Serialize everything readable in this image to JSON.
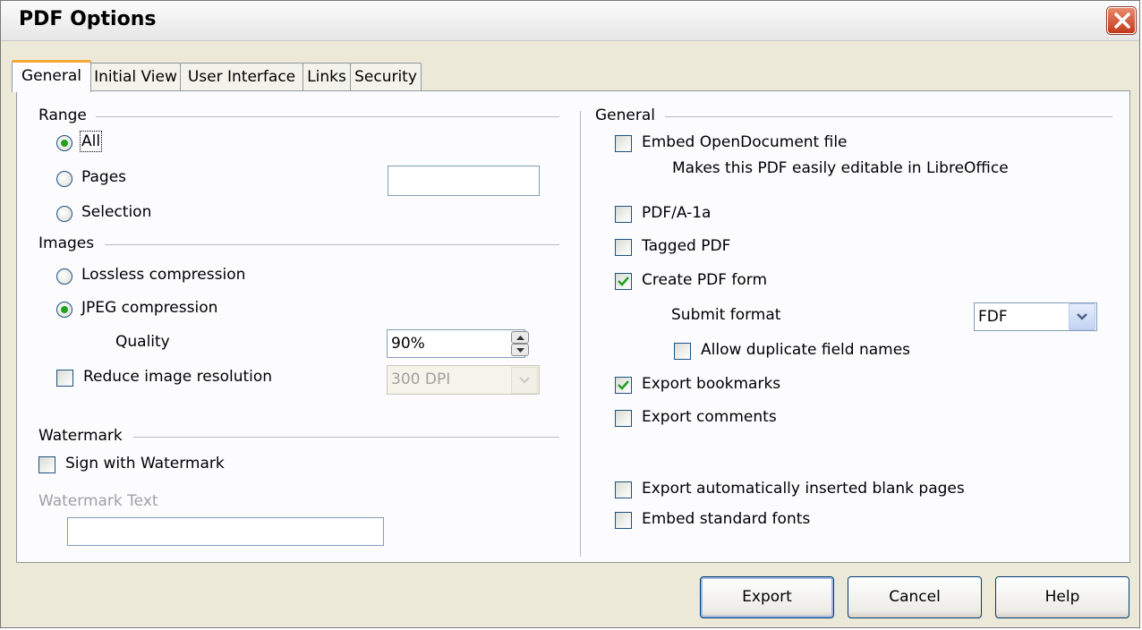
{
  "window": {
    "title": "PDF Options"
  },
  "tabs": [
    {
      "label": "General",
      "active": true
    },
    {
      "label": "Initial View"
    },
    {
      "label": "User Interface"
    },
    {
      "label": "Links"
    },
    {
      "label": "Security"
    }
  ],
  "left": {
    "range": {
      "title": "Range",
      "all": "All",
      "pages": "Pages",
      "pages_value": "",
      "selection": "Selection",
      "selected": "All"
    },
    "images": {
      "title": "Images",
      "lossless": "Lossless compression",
      "jpeg": "JPEG compression",
      "selected": "JPEG compression",
      "quality_label": "Quality",
      "quality_value": "90%",
      "reduce_label": "Reduce image resolution",
      "reduce_checked": false,
      "resolution_value": "300 DPI"
    },
    "watermark": {
      "title": "Watermark",
      "sign_label": "Sign with Watermark",
      "sign_checked": false,
      "text_label": "Watermark Text",
      "text_value": ""
    }
  },
  "right": {
    "title": "General",
    "embed_odf": {
      "label": "Embed OpenDocument file",
      "checked": false,
      "hint": "Makes this PDF easily editable in LibreOffice"
    },
    "pdfa": {
      "label": "PDF/A-1a",
      "checked": false
    },
    "tagged": {
      "label": "Tagged PDF",
      "checked": false
    },
    "create_form": {
      "label": "Create PDF form",
      "checked": true
    },
    "submit_format": {
      "label": "Submit format",
      "value": "FDF"
    },
    "allow_duplicate": {
      "label": "Allow duplicate field names",
      "checked": false
    },
    "export_bookmarks": {
      "label": "Export bookmarks",
      "checked": true
    },
    "export_comments": {
      "label": "Export comments",
      "checked": false
    },
    "export_blank": {
      "label": "Export automatically inserted blank pages",
      "checked": false
    },
    "embed_fonts": {
      "label": "Embed standard fonts",
      "checked": false
    }
  },
  "buttons": {
    "export": "Export",
    "cancel": "Cancel",
    "help": "Help"
  },
  "icons": {
    "close": "close-icon",
    "check": "checkmark-icon",
    "dropdown": "chevron-down-icon",
    "spin": "spin-arrows-icon"
  },
  "colors": {
    "close_button": "#c2391b",
    "tab_highlight": "#f5a836",
    "check_mark": "#21a121"
  }
}
